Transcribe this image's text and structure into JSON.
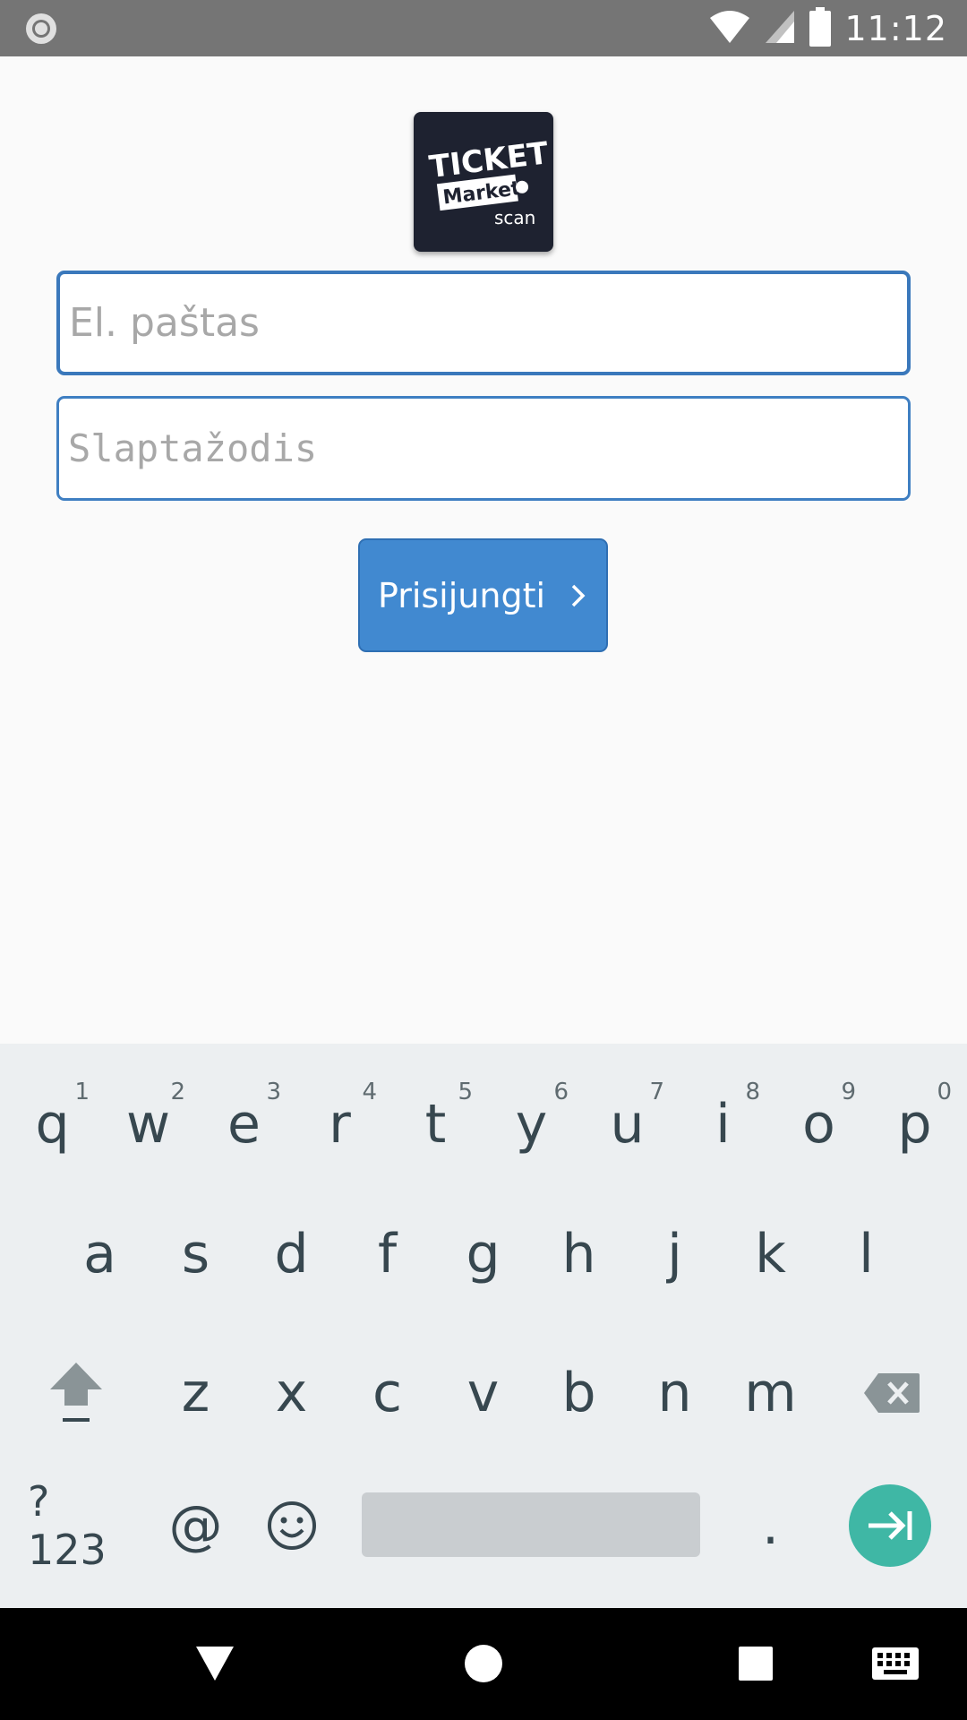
{
  "status_bar": {
    "time": "11:12",
    "icons": [
      "record-icon",
      "wifi-icon",
      "signal-icon",
      "battery-icon"
    ]
  },
  "logo": {
    "line1": "TICKET",
    "line2": "Market",
    "line3": "scan",
    "background": "#1e2230"
  },
  "form": {
    "email_placeholder": "El. paštas",
    "email_value": "",
    "password_placeholder": "Slaptažodis",
    "password_value": "",
    "login_label": "Prisijungti"
  },
  "colors": {
    "accent": "#4189d0",
    "field_border": "#3f7fc2",
    "enter_key": "#3fb7a5"
  },
  "keyboard": {
    "row1": [
      {
        "key": "q",
        "hint": "1"
      },
      {
        "key": "w",
        "hint": "2"
      },
      {
        "key": "e",
        "hint": "3"
      },
      {
        "key": "r",
        "hint": "4"
      },
      {
        "key": "t",
        "hint": "5"
      },
      {
        "key": "y",
        "hint": "6"
      },
      {
        "key": "u",
        "hint": "7"
      },
      {
        "key": "i",
        "hint": "8"
      },
      {
        "key": "o",
        "hint": "9"
      },
      {
        "key": "p",
        "hint": "0"
      }
    ],
    "row2": [
      "a",
      "s",
      "d",
      "f",
      "g",
      "h",
      "j",
      "k",
      "l"
    ],
    "row3": [
      "z",
      "x",
      "c",
      "v",
      "b",
      "n",
      "m"
    ],
    "symbols_label": "?123",
    "at_label": "@",
    "period_label": "."
  },
  "nav_bar": {
    "icons": [
      "back-icon",
      "home-icon",
      "recents-icon",
      "keyboard-switch-icon"
    ]
  }
}
